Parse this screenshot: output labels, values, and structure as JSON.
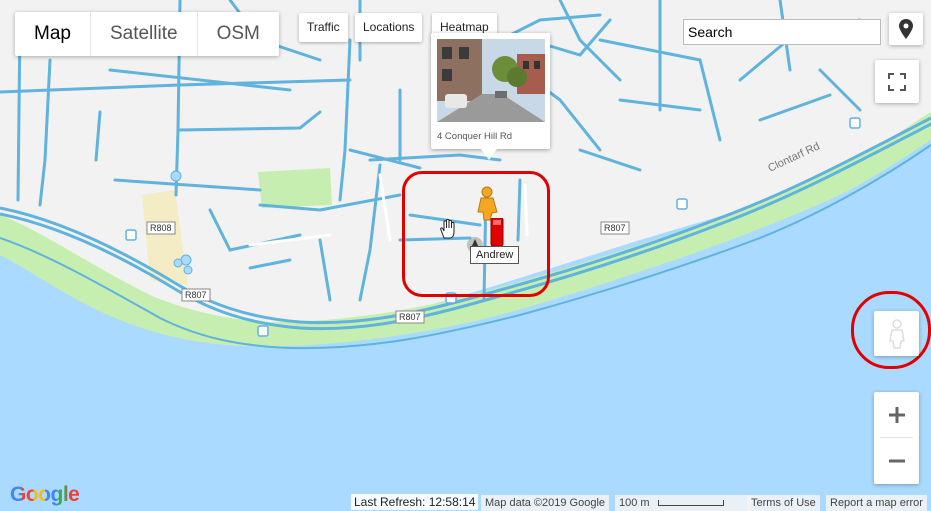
{
  "map_types": [
    {
      "label": "Map",
      "active": true
    },
    {
      "label": "Satellite",
      "active": false
    },
    {
      "label": "OSM",
      "active": false
    }
  ],
  "layers": {
    "traffic": "Traffic",
    "locations": "Locations",
    "heatmap": "Heatmap"
  },
  "search": {
    "placeholder": "Search"
  },
  "popup": {
    "address": "4 Conquer Hill Rd"
  },
  "marker": {
    "label": "Andrew"
  },
  "road_labels": {
    "r808": "R808",
    "r807a": "R807",
    "r807b": "R807",
    "r807c": "R807",
    "clontarf": "Clontarf Rd"
  },
  "footer": {
    "last_refresh_label": "Last Refresh:",
    "last_refresh_time": "12:58:14",
    "map_data": "Map data ©2019 Google",
    "scale": "100 m",
    "terms": "Terms of Use",
    "report": "Report a map error"
  },
  "logo": {
    "text": "Google"
  },
  "colors": {
    "water": "#aadaff",
    "land": "#f2f2f2",
    "park": "#c6eeb0",
    "road": "#5fb3dc",
    "highlight": "#e00000"
  }
}
